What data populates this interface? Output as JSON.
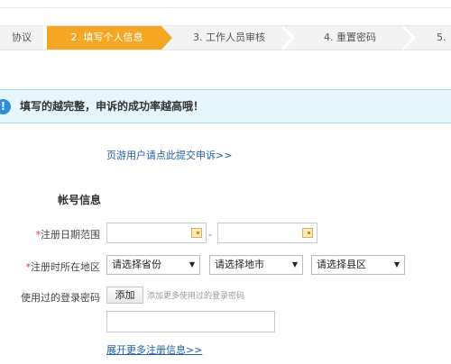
{
  "steps": [
    {
      "label": "协议",
      "state": "done"
    },
    {
      "label": "2. 填写个人信息",
      "state": "active"
    },
    {
      "label": "3. 工作人员审核",
      "state": "pending"
    },
    {
      "label": "4. 重置密码",
      "state": "pending"
    },
    {
      "label": "5.",
      "state": "pending"
    }
  ],
  "notice": {
    "icon": "info-icon",
    "icon_glyph": "!",
    "text": "填写的越完整，申诉的成功率越高哦！"
  },
  "appeal_link": "页游用户请点此提交申诉>>",
  "section_title": "帐号信息",
  "form": {
    "reg_date": {
      "required_mark": "*",
      "label": "注册日期范围",
      "separator": "-",
      "start_value": "",
      "end_value": ""
    },
    "reg_region": {
      "required_mark": "*",
      "label": "注册时所在地区",
      "province": "请选择省份",
      "city": "请选择地市",
      "district": "请选择县区"
    },
    "used_passwords": {
      "label": "使用过的登录密码",
      "add_button": "添加",
      "hint": "添加更多使用过的登录密码",
      "value": ""
    }
  },
  "more_link": "展开更多注册信息>>",
  "colors": {
    "active_step": "#f5a623",
    "notice_bg": "#e6f6fd",
    "link": "#1f5fa8",
    "required": "#e33333"
  }
}
